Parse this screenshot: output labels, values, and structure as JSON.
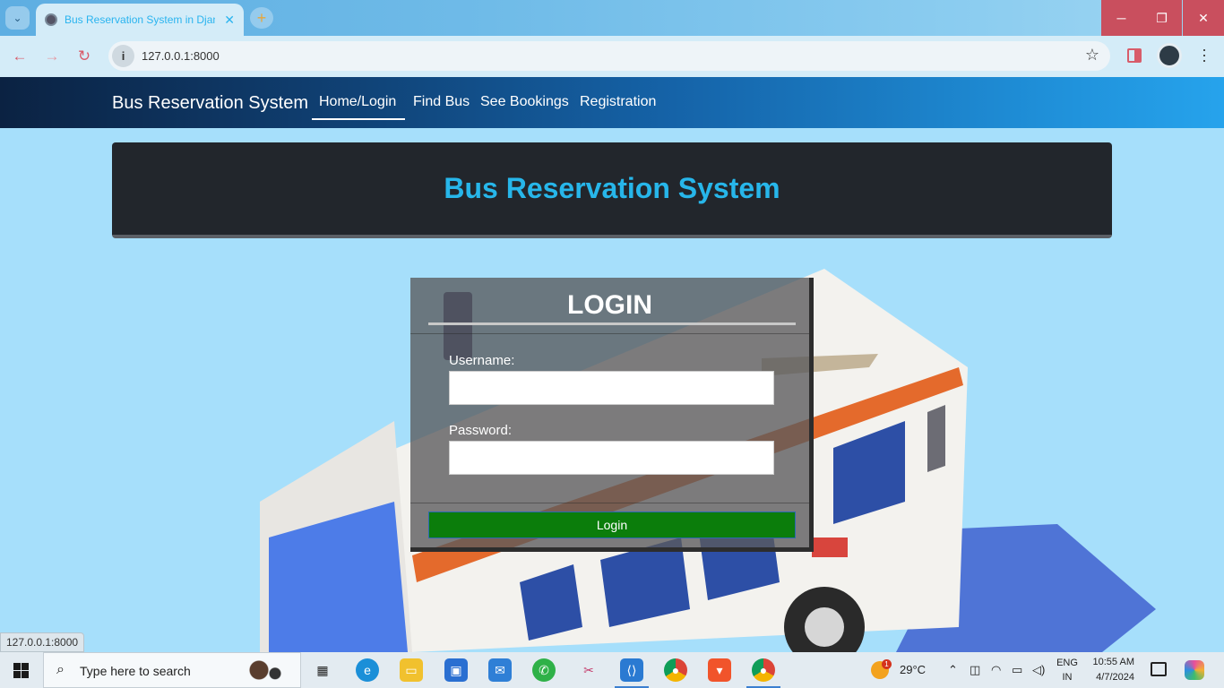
{
  "browser": {
    "tab_title": "Bus Reservation System in Djan",
    "url": "127.0.0.1:8000",
    "status_url": "127.0.0.1:8000"
  },
  "navbar": {
    "brand": "Bus Reservation System",
    "links": [
      "Home/Login",
      "Find Bus",
      "See Bookings",
      "Registration"
    ],
    "active": "Home/Login"
  },
  "hero": {
    "title": "Bus Reservation System"
  },
  "login": {
    "heading": "LOGIN",
    "username_label": "Username:",
    "username_value": "",
    "password_label": "Password:",
    "password_value": "",
    "submit_label": "Login"
  },
  "taskbar": {
    "search_placeholder": "Type here to search",
    "weather_alert_count": "1",
    "temperature": "29°C",
    "language": "ENG",
    "region": "IN",
    "time": "10:55 AM",
    "date": "4/7/2024"
  },
  "colors": {
    "accent": "#27b6ea",
    "hero_bg": "#22262c",
    "login_button": "#0b7d0b",
    "window_controls": "#c94f5e"
  },
  "icons": {
    "tab_favicon": "globe-icon",
    "site_info": "info-icon",
    "bookmark": "star-icon",
    "profile": "profile-avatar-icon",
    "menu": "kebab-menu-icon",
    "weather": "sun-icon"
  }
}
